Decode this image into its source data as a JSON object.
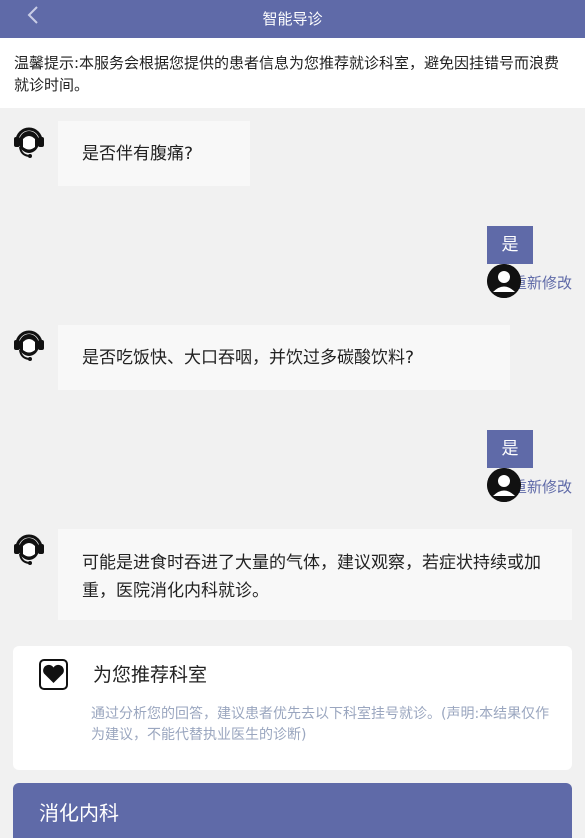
{
  "header": {
    "back_icon": "chevron-left-icon",
    "title": "智能导诊"
  },
  "notice": {
    "text": "温馨提示:本服务会根据您提供的患者信息为您推荐就诊科室，避免因挂错号而浪费就诊时间。"
  },
  "chat": {
    "q1": "是否伴有腹痛?",
    "a1": "是",
    "modify1": "重新修改",
    "q2": "是否吃饭快、大口吞咽，并饮过多碳酸饮料?",
    "a2": "是",
    "modify2": "重新修改",
    "result": "可能是进食时吞进了大量的气体，建议观察，若症状持续或加重，医院消化内科就诊。"
  },
  "recommend": {
    "icon": "heart-icon",
    "title": "为您推荐科室",
    "desc": "通过分析您的回答，建议患者优先去以下科室挂号就诊。(声明:本结果仅作为建议，不能代替执业医生的诊断)",
    "department": "消化内科"
  },
  "colors": {
    "primary": "#5f6aa8",
    "background": "#f1f1f1",
    "bubble": "#f8f8f8",
    "desc_text": "#9aa6bf"
  }
}
